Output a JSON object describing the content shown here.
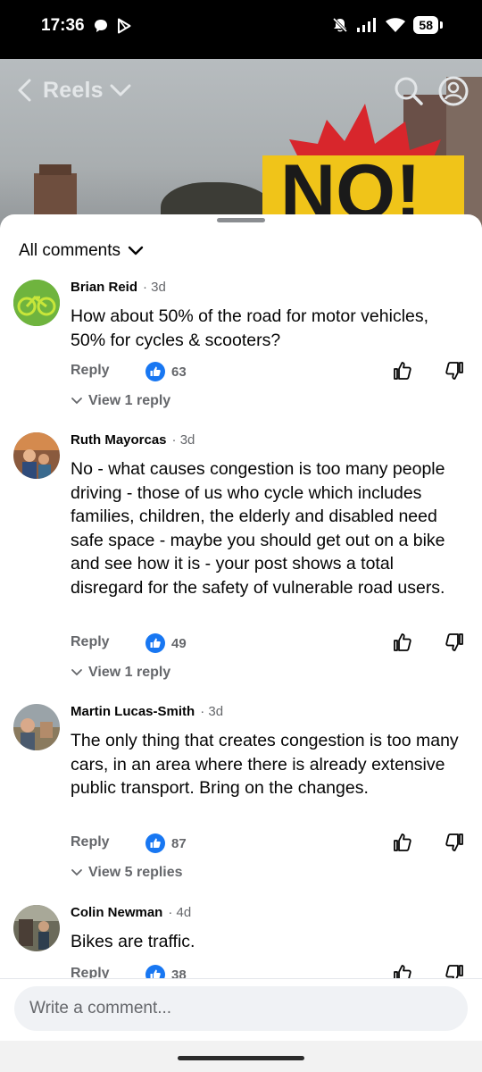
{
  "status_bar": {
    "time": "17:36",
    "battery": "58",
    "icons": [
      "chat-bubble-icon",
      "play-store-icon",
      "mute-icon",
      "signal-icon",
      "wifi-icon",
      "battery-icon"
    ]
  },
  "header": {
    "back_icon": "chevron-left-icon",
    "title": "Reels",
    "dropdown_icon": "chevron-down-icon",
    "search_icon": "search-icon",
    "profile_icon": "profile-icon"
  },
  "video_overlay": {
    "caption_text": "NO!"
  },
  "comments_panel": {
    "filter_label": "All comments",
    "reply_label": "Reply",
    "comments": [
      {
        "author": "Brian Reid",
        "time": "· 3d",
        "text": "How about 50% of the road for motor vehicles, 50% for cycles & scooters?",
        "likes": "63",
        "replies_label": "View 1 reply"
      },
      {
        "author": "Ruth Mayorcas",
        "time": "· 3d",
        "text": "No - what causes congestion is too many people driving - those of us who cycle which includes families, children, the elderly and disabled need safe space - maybe you should get out on a bike and see how it is - your post shows a total disregard for the safety of vulnerable road users.",
        "likes": "49",
        "replies_label": "View 1 reply"
      },
      {
        "author": "Martin Lucas-Smith",
        "time": "· 3d",
        "text": "The only thing that creates congestion is too many cars, in an area where there is already extensive public transport. Bring on the changes.",
        "likes": "87",
        "replies_label": "View 5 replies"
      },
      {
        "author": "Colin Newman",
        "time": "· 4d",
        "text": "Bikes are traffic.",
        "likes": "38"
      }
    ]
  },
  "composer": {
    "placeholder": "Write a comment..."
  },
  "colors": {
    "like_blue": "#1877f2",
    "secondary_text": "#65676b",
    "primary_text": "#050505",
    "burst_yellow": "#f0c419",
    "burst_red": "#d8262c"
  }
}
